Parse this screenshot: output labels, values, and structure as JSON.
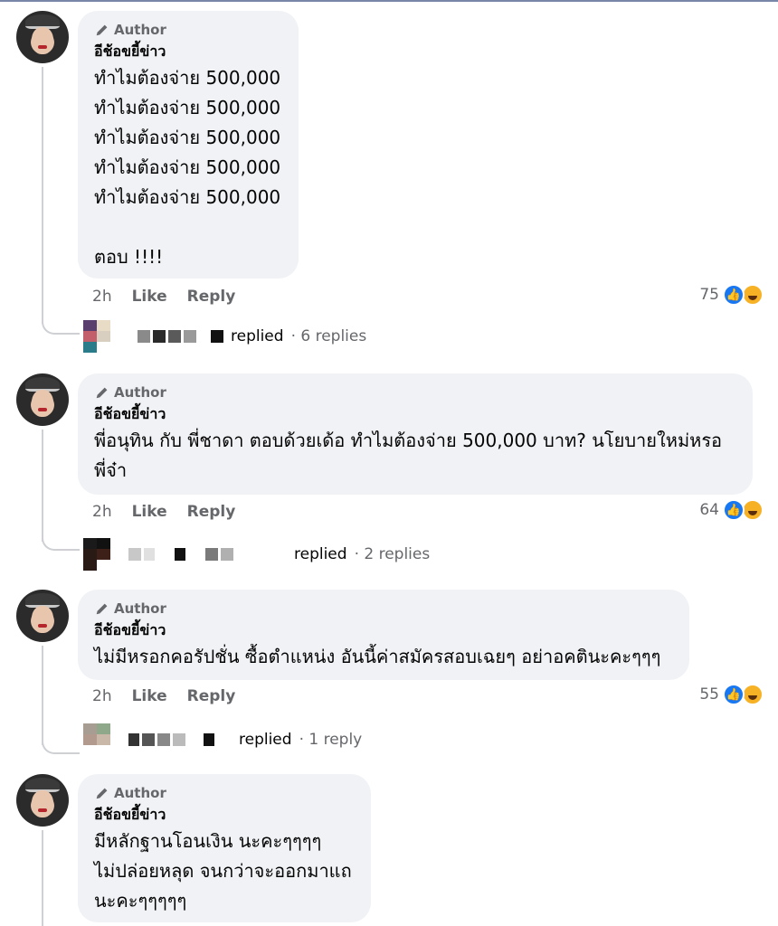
{
  "badge_label": "Author",
  "author_name": "อีช้อขยี้ข่าว",
  "actions": {
    "like": "Like",
    "reply": "Reply"
  },
  "colors": {
    "bubble": "#f0f2f5",
    "like": "#1877f2",
    "haha": "#f7b125"
  },
  "comments": [
    {
      "text": "ทำไมต้องจ่าย 500,000\nทำไมต้องจ่าย 500,000\nทำไมต้องจ่าย 500,000\nทำไมต้องจ่าย 500,000\nทำไมต้องจ่าย 500,000\n\nตอบ !!!!",
      "time": "2h",
      "reaction_count": "75",
      "reply_label": "replied",
      "reply_count": "· 6 replies"
    },
    {
      "text": "พี่อนุทิน กับ พี่ชาดา ตอบด้วยเด้อ ทำไมต้องจ่าย 500,000 บาท? นโยบายใหม่หรอ\nพี่จ๋า",
      "time": "2h",
      "reaction_count": "64",
      "reply_label": "replied",
      "reply_count": "· 2 replies"
    },
    {
      "text": "ไม่มีหรอกคอรัปชั่น ซื้อตำแหน่ง อันนี้ค่าสมัครสอบเฉยๆ อย่าอคตินะคะๆๆๆ",
      "time": "2h",
      "reaction_count": "55",
      "reply_label": "replied",
      "reply_count": "· 1 reply"
    },
    {
      "text": "มีหลักฐานโอนเงิน นะคะๆๆๆๆ\nไม่ปล่อยหลุด จนกว่าจะออกมาแถ\nนะคะๆๆๆๆๆ"
    }
  ]
}
